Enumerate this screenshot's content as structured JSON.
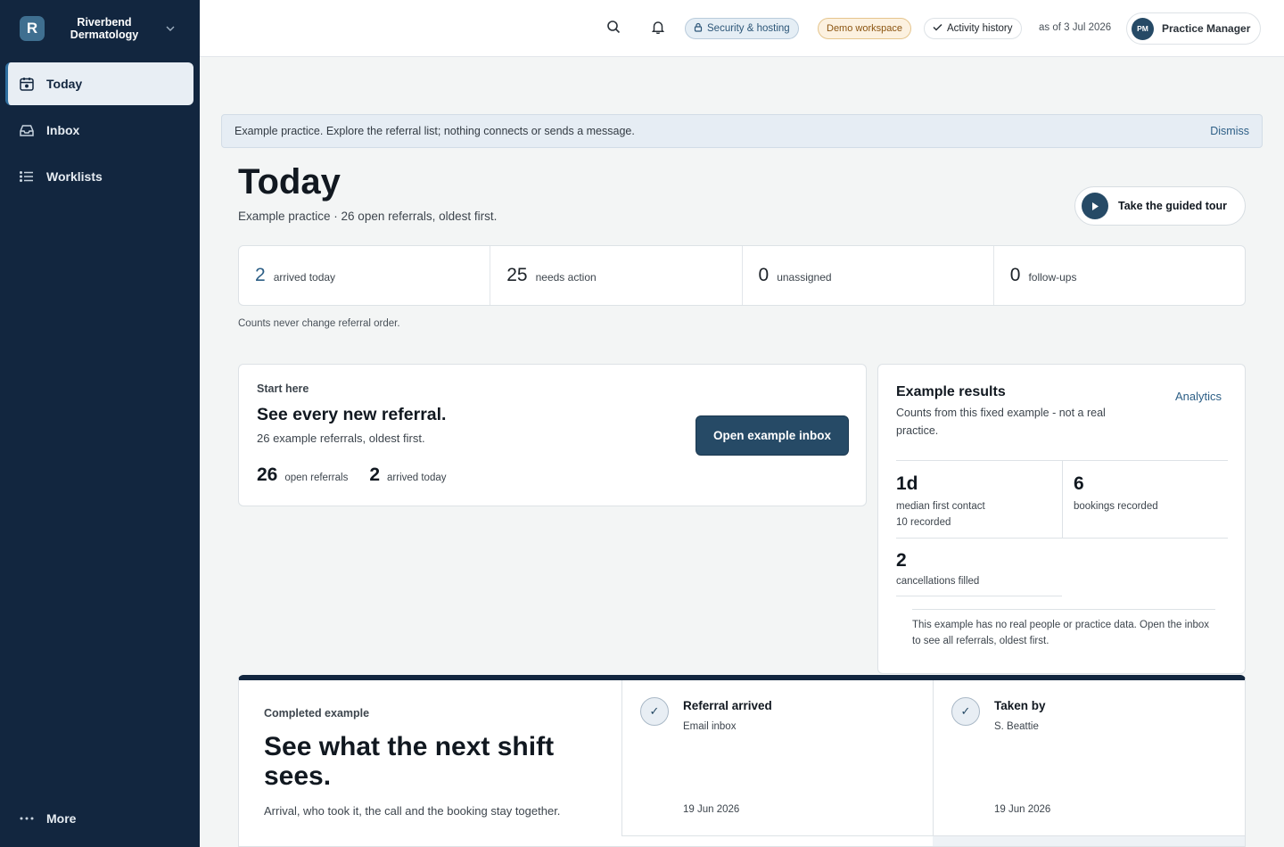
{
  "workspace": {
    "logo_letter": "R",
    "name_line1": "Riverbend",
    "name_line2": "Dermatology"
  },
  "nav": {
    "items": [
      {
        "label": "Today",
        "icon": "calendar-icon",
        "active": true
      },
      {
        "label": "Inbox",
        "icon": "inbox-icon",
        "active": false
      },
      {
        "label": "Worklists",
        "icon": "list-icon",
        "active": false
      }
    ],
    "more_label": "More"
  },
  "topbar": {
    "security_label": "Security & hosting",
    "demo_label": "Demo workspace",
    "activity_label": "Activity history",
    "as_of": "as of 3 Jul 2026",
    "user_initials": "PM",
    "user_name": "Practice Manager"
  },
  "banner": {
    "text": "Example practice. Explore the referral list; nothing connects or sends a message.",
    "dismiss": "Dismiss"
  },
  "header": {
    "title": "Today",
    "subtitle": "Example practice · 26 open referrals, oldest first.",
    "tour_label": "Take the guided tour"
  },
  "counts": [
    {
      "value": "2",
      "label": "arrived today"
    },
    {
      "value": "25",
      "label": "needs action"
    },
    {
      "value": "0",
      "label": "unassigned"
    },
    {
      "value": "0",
      "label": "follow-ups"
    }
  ],
  "counts_note": "Counts never change referral order.",
  "start": {
    "eyebrow": "Start here",
    "title": "See every new referral.",
    "subtitle": "26 example referrals, oldest first.",
    "stat1_value": "26",
    "stat1_label": "open referrals",
    "stat2_value": "2",
    "stat2_label": "arrived today",
    "button": "Open example inbox"
  },
  "results": {
    "title": "Example results",
    "link": "Analytics",
    "subtitle": "Counts from this fixed example - not a real practice.",
    "m1_value": "1d",
    "m1_label": "median first contact",
    "m1_sub": "10 recorded",
    "m2_value": "6",
    "m2_label": "bookings recorded",
    "m3_value": "2",
    "m3_label": "cancellations filled",
    "note": "This example has no real people or practice data. Open the inbox to see all referrals, oldest first."
  },
  "completed": {
    "eyebrow": "Completed example",
    "title": "See what the next shift sees.",
    "subtitle": "Arrival, who took it, the call and the booking stay together.",
    "steps": [
      {
        "title": "Referral arrived",
        "sub": "Email inbox",
        "date": "19 Jun 2026"
      },
      {
        "title": "Taken by",
        "sub": "S. Beattie",
        "date": "19 Jun 2026"
      }
    ]
  },
  "colors": {
    "sidebar": "#12263f",
    "accent": "#264a66",
    "link": "#2d5f86"
  }
}
